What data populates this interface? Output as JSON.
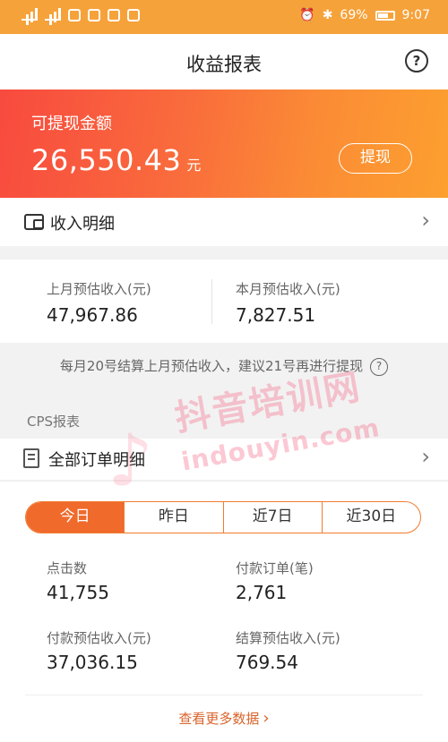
{
  "status_bar": {
    "battery": "69%",
    "time": "9:07"
  },
  "header": {
    "title": "收益报表",
    "help": "?"
  },
  "balance": {
    "label": "可提现金额",
    "amount": "26,550.43",
    "unit": "元",
    "withdraw_label": "提现"
  },
  "income_detail": {
    "label": "收入明细",
    "chevron": "›"
  },
  "summary": {
    "last_month_label": "上月预估收入(元)",
    "last_month_value": "47,967.86",
    "this_month_label": "本月预估收入(元)",
    "this_month_value": "7,827.51"
  },
  "note": {
    "text": "每月20号结算上月预估收入，建议21号再进行提现",
    "icon": "?"
  },
  "cps": {
    "section_title": "CPS报表",
    "all_orders_label": "全部订单明细",
    "chevron": "›",
    "tabs": [
      {
        "label": "今日",
        "active": true
      },
      {
        "label": "昨日",
        "active": false
      },
      {
        "label": "近7日",
        "active": false
      },
      {
        "label": "近30日",
        "active": false
      }
    ],
    "stats": {
      "clicks_label": "点击数",
      "clicks_value": "41,755",
      "paid_orders_label": "付款订单(笔)",
      "paid_orders_value": "2,761",
      "paid_est_label": "付款预估收入(元)",
      "paid_est_value": "37,036.15",
      "settled_est_label": "结算预估收入(元)",
      "settled_est_value": "769.54"
    },
    "more_label": "查看更多数据",
    "more_arrow": "›"
  },
  "watermark": {
    "logo": "♪",
    "cn": "抖音培训网",
    "en": "indouyin.com"
  },
  "colors": {
    "status_bar": "#f6a23a",
    "banner_start": "#f84a3f",
    "banner_end": "#fca02f",
    "accent": "#f06a2c",
    "link": "#d8632a"
  }
}
